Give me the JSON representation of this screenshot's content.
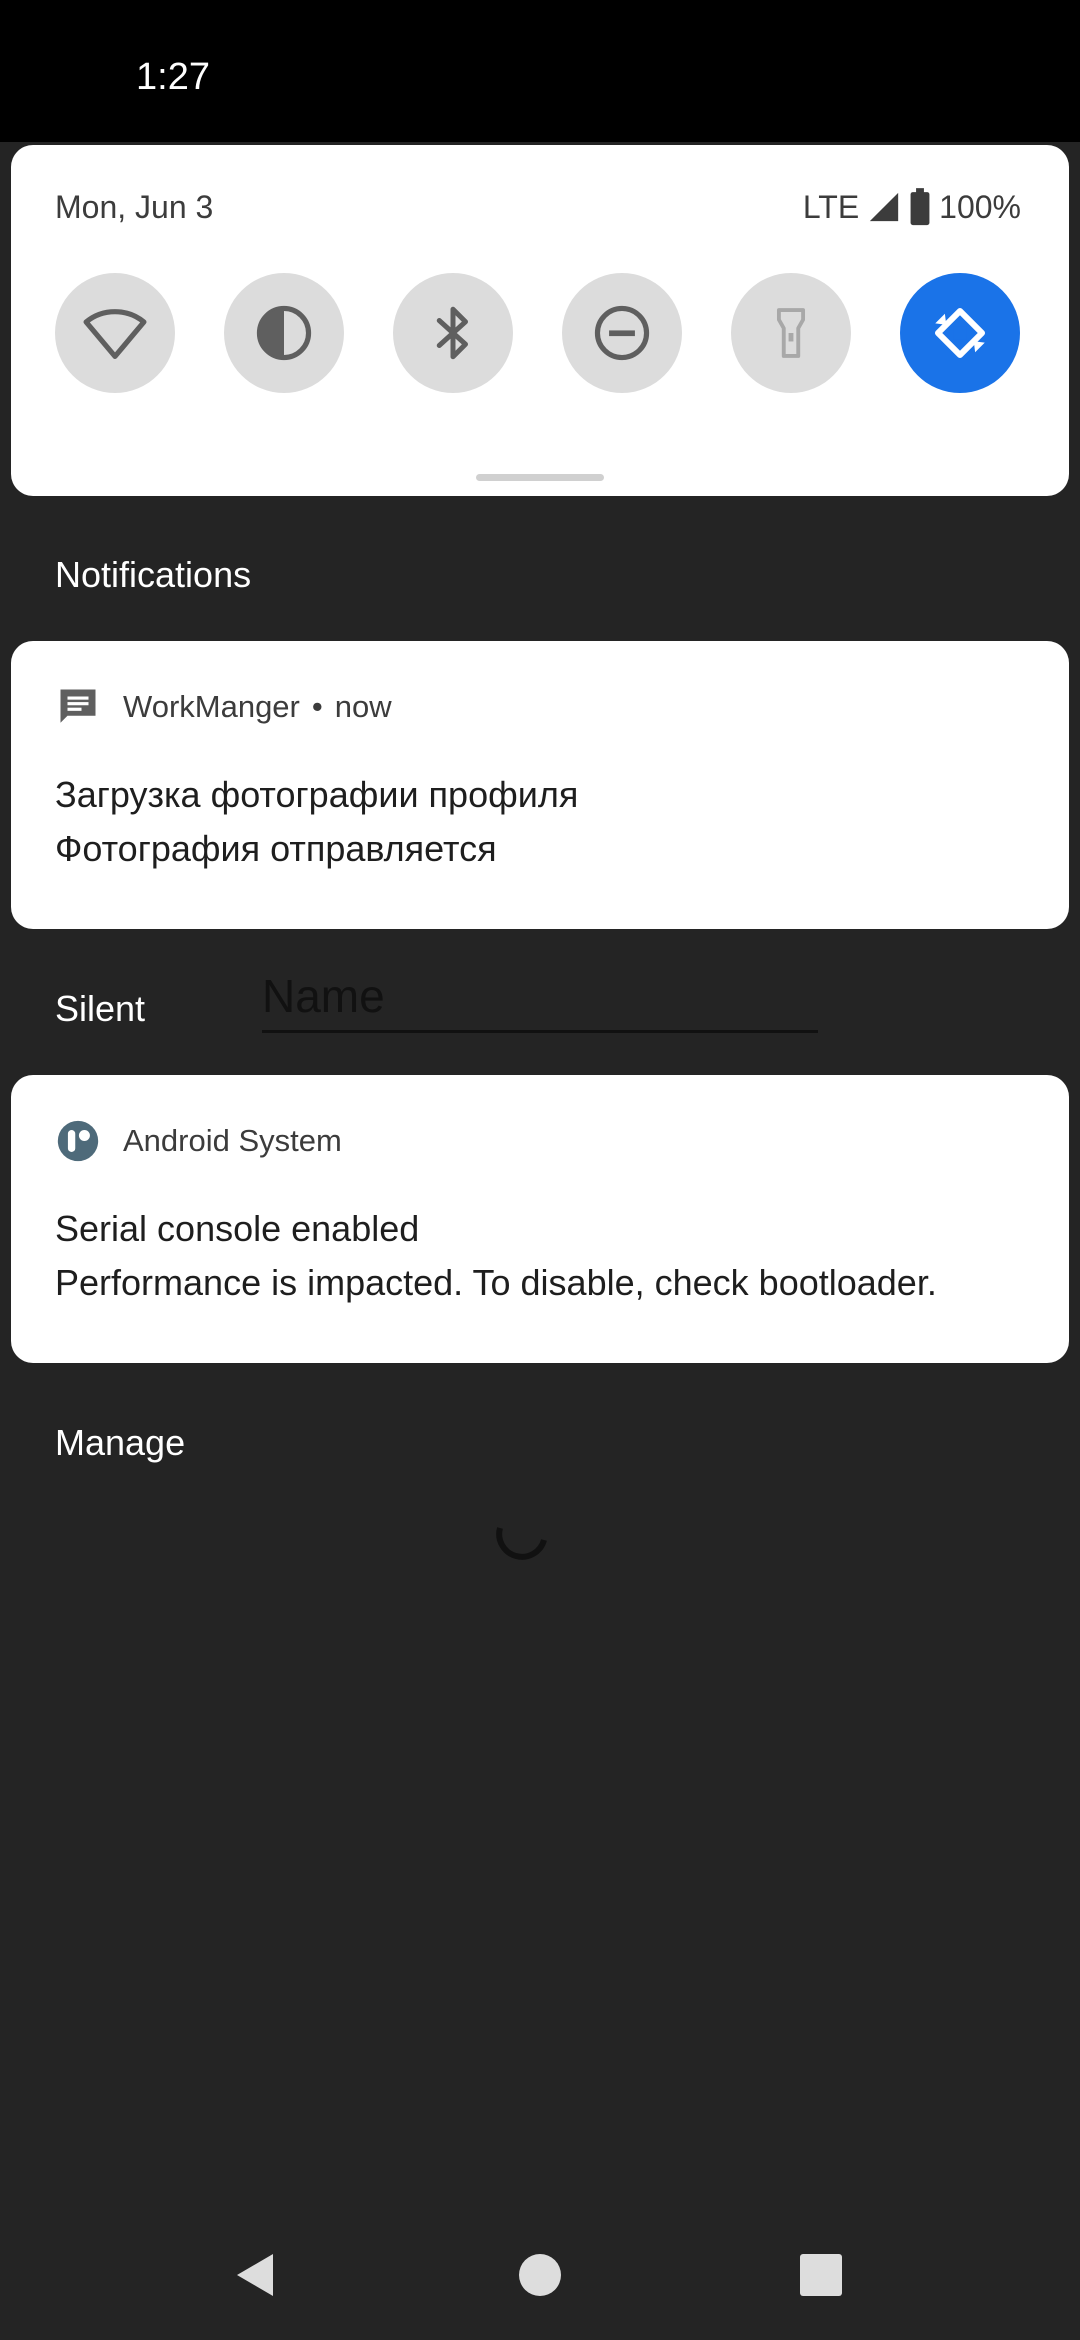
{
  "status_bar": {
    "time": "1:27"
  },
  "quick_settings": {
    "date": "Mon, Jun 3",
    "network": "LTE",
    "battery": "100%",
    "tiles": [
      {
        "name": "wifi",
        "icon": "wifi-icon",
        "active": false
      },
      {
        "name": "invert-colors",
        "icon": "invert-colors-icon",
        "active": false
      },
      {
        "name": "bluetooth",
        "icon": "bluetooth-icon",
        "active": false
      },
      {
        "name": "do-not-disturb",
        "icon": "do-not-disturb-icon",
        "active": false
      },
      {
        "name": "flashlight",
        "icon": "flashlight-icon",
        "active": false
      },
      {
        "name": "auto-rotate",
        "icon": "auto-rotate-icon",
        "active": true
      }
    ]
  },
  "sections": {
    "notifications_label": "Notifications",
    "silent_label": "Silent",
    "manage_label": "Manage"
  },
  "notifications": [
    {
      "app": "WorkManger",
      "time": "now",
      "icon": "message-icon",
      "title": "Загрузка фотографии профиля",
      "text": "Фотография отправляется"
    },
    {
      "app": "Android System",
      "icon": "android-system-icon",
      "title": "Serial console enabled",
      "text": "Performance is impacted. To disable, check bootloader."
    }
  ],
  "name_input": {
    "placeholder": "Name",
    "value": ""
  },
  "colors": {
    "accent": "#1a73e8",
    "shade_background": "#242424",
    "card_background": "#ffffff",
    "tile_inactive": "#dcdcdc"
  }
}
